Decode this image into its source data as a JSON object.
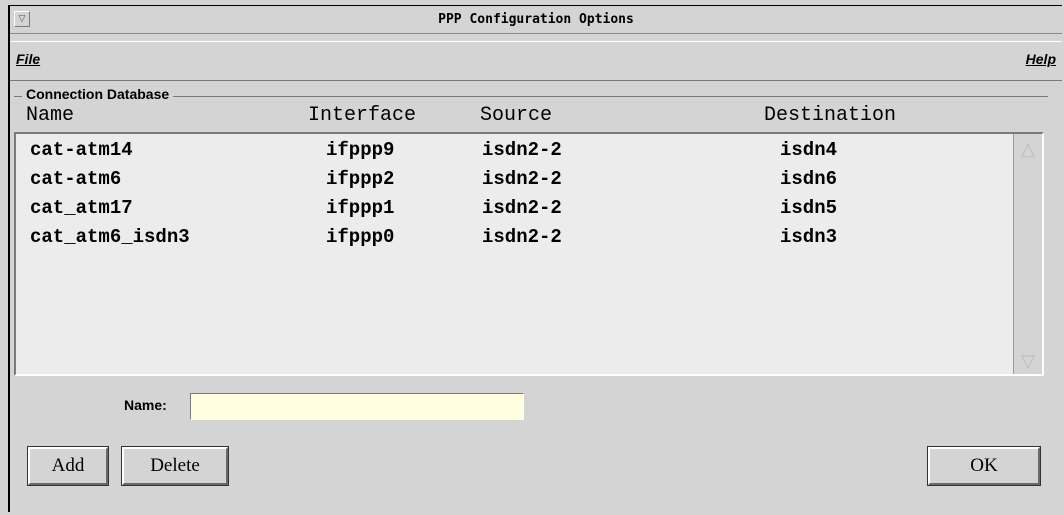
{
  "window": {
    "title": "PPP Configuration Options",
    "menu_glyph": "▽"
  },
  "menubar": {
    "file": "File",
    "help": "Help"
  },
  "connections": {
    "group_label": "Connection Database",
    "columns": [
      "Name",
      "Interface",
      "Source",
      "Destination"
    ],
    "rows": [
      {
        "name": "cat-atm14",
        "interface": "ifppp9",
        "source": "isdn2-2",
        "destination": "isdn4"
      },
      {
        "name": "cat-atm6",
        "interface": "ifppp2",
        "source": "isdn2-2",
        "destination": "isdn6"
      },
      {
        "name": "cat_atm17",
        "interface": "ifppp1",
        "source": "isdn2-2",
        "destination": "isdn5"
      },
      {
        "name": "cat_atm6_isdn3",
        "interface": "ifppp0",
        "source": "isdn2-2",
        "destination": "isdn3"
      }
    ],
    "scroll_up": "△",
    "scroll_down": "▽"
  },
  "form": {
    "name_label": "Name:",
    "name_value": ""
  },
  "buttons": {
    "add": "Add",
    "delete": "Delete",
    "ok": "OK"
  }
}
